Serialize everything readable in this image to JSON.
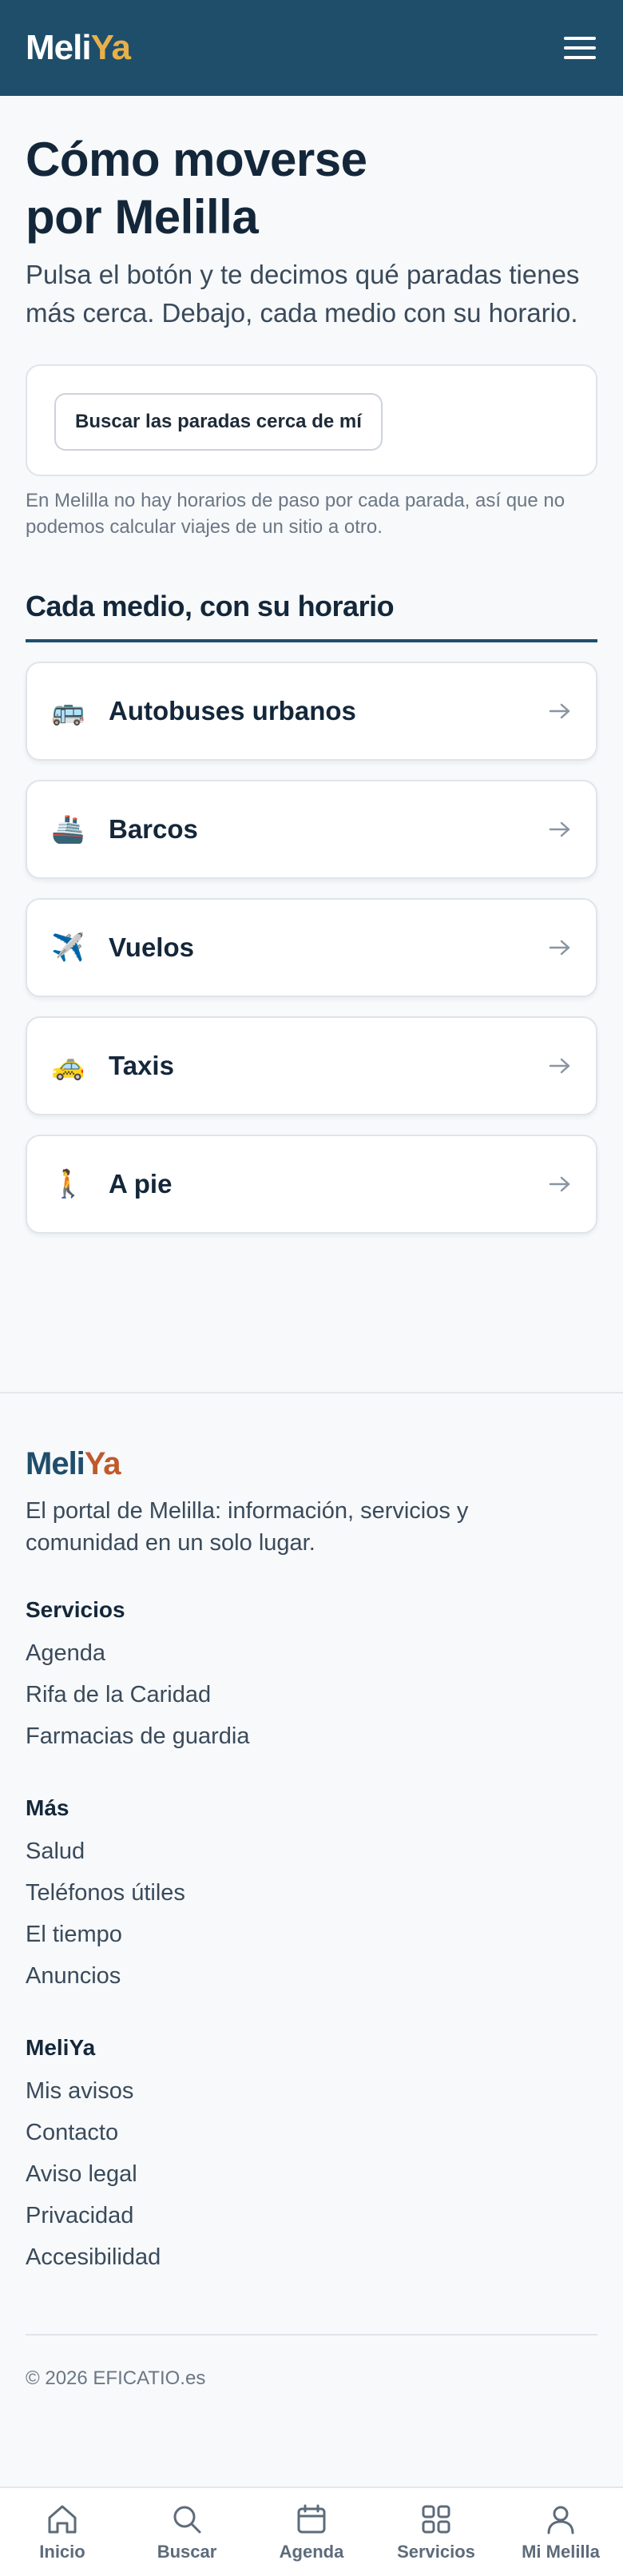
{
  "header": {
    "logo_part1": "Meli",
    "logo_part2": "Ya",
    "menu_icon": "hamburger-menu-icon"
  },
  "main": {
    "title_line1": "Cómo moverse",
    "title_line2": "por Melilla",
    "lead_line1": "Pulsa el botón y te decimos qué paradas tienes",
    "lead_line2": "más cerca. Debajo, cada medio con su horario.",
    "near_button": "Buscar las paradas cerca de mí",
    "note_line1": "En Melilla no hay horarios de paso por cada parada, así que no",
    "note_line2": "podemos calcular viajes de un sitio a otro.",
    "section_title": "Cada medio, con su horario",
    "modes": [
      {
        "icon": "🚌",
        "icon_name": "bus-icon",
        "label": "Autobuses urbanos"
      },
      {
        "icon": "🚢",
        "icon_name": "ship-icon",
        "label": "Barcos"
      },
      {
        "icon": "✈️",
        "icon_name": "airplane-icon",
        "label": "Vuelos"
      },
      {
        "icon": "🚕",
        "icon_name": "taxi-icon",
        "label": "Taxis"
      },
      {
        "icon": "🚶",
        "icon_name": "pedestrian-icon",
        "label": "A pie"
      }
    ]
  },
  "footer": {
    "logo_part1": "Meli",
    "logo_part2": "Ya",
    "tagline_line1": "El portal de Melilla: información, servicios y",
    "tagline_line2": "comunidad en un solo lugar.",
    "groups": [
      {
        "title": "Servicios",
        "links": [
          "Agenda",
          "Rifa de la Caridad",
          "Farmacias de guardia"
        ]
      },
      {
        "title": "Más",
        "links": [
          "Salud",
          "Teléfonos útiles",
          "El tiempo",
          "Anuncios"
        ]
      },
      {
        "title": "MeliYa",
        "links": [
          "Mis avisos",
          "Contacto",
          "Aviso legal",
          "Privacidad",
          "Accesibilidad"
        ]
      }
    ],
    "copyright": "© 2026 EFICATIO.es"
  },
  "bottom_nav": [
    {
      "label": "Inicio",
      "icon": "home-icon"
    },
    {
      "label": "Buscar",
      "icon": "search-icon"
    },
    {
      "label": "Agenda",
      "icon": "calendar-icon"
    },
    {
      "label": "Servicios",
      "icon": "grid-icon"
    },
    {
      "label": "Mi Melilla",
      "icon": "user-icon"
    }
  ],
  "colors": {
    "brand_dark": "#1f4e6b",
    "brand_accent": "#e8b04a",
    "footer_accent": "#c05a2a"
  }
}
